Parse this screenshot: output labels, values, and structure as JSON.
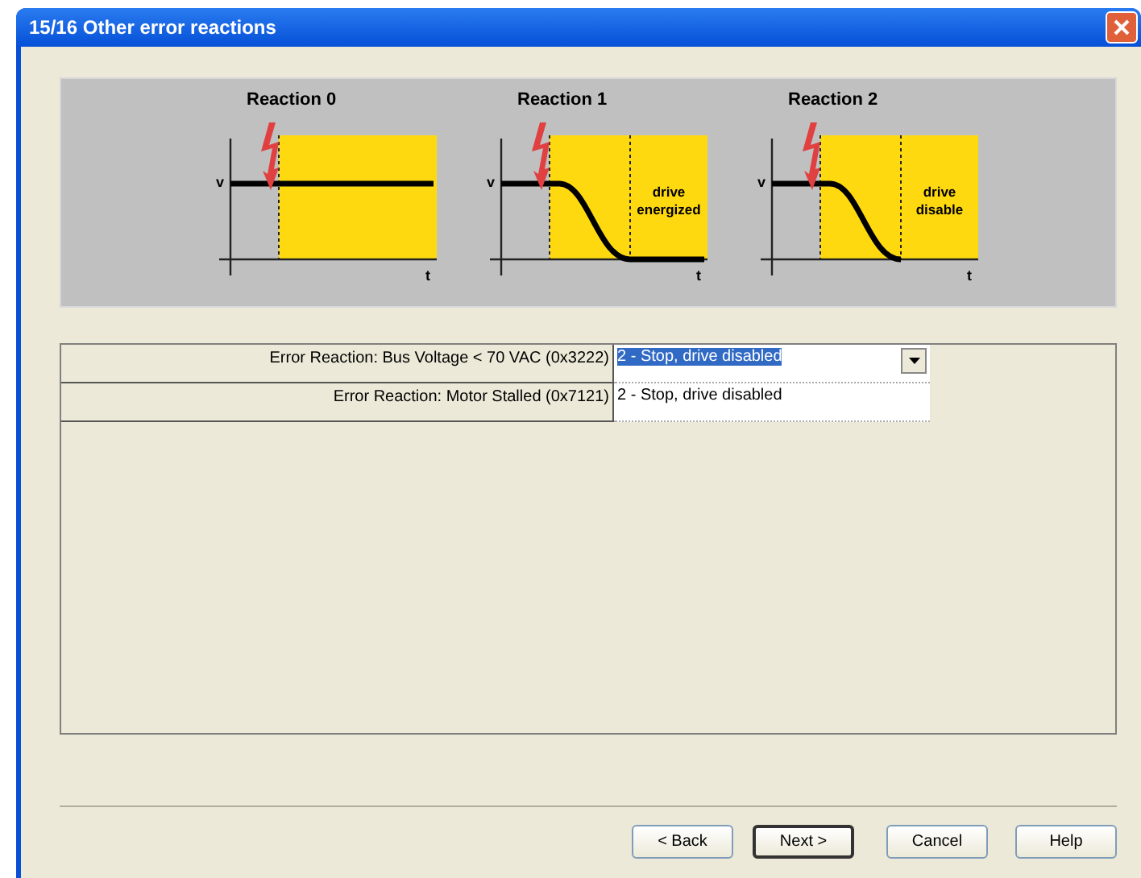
{
  "window": {
    "title": "15/16 Other error reactions"
  },
  "reactions": [
    {
      "title": "Reaction 0",
      "kind": "constant",
      "v_label": "v",
      "t_label": "t"
    },
    {
      "title": "Reaction 1",
      "kind": "stop_energized",
      "v_label": "v",
      "t_label": "t",
      "note": "drive energized"
    },
    {
      "title": "Reaction 2",
      "kind": "stop_disabled",
      "v_label": "v",
      "t_label": "t",
      "note": "drive disable"
    }
  ],
  "parameters": [
    {
      "label": "Error Reaction: Bus Voltage < 70 VAC (0x3222)",
      "value": "2 - Stop, drive disabled",
      "kind": "dropdown",
      "selected": true
    },
    {
      "label": "Error Reaction: Motor Stalled (0x7121)",
      "value": "2 - Stop, drive disabled",
      "kind": "text",
      "selected": false
    }
  ],
  "buttons": [
    {
      "label": "< Back",
      "default": false
    },
    {
      "label": "Next >",
      "default": true
    },
    {
      "label": "Cancel",
      "default": false
    },
    {
      "label": "Help",
      "default": false
    }
  ]
}
